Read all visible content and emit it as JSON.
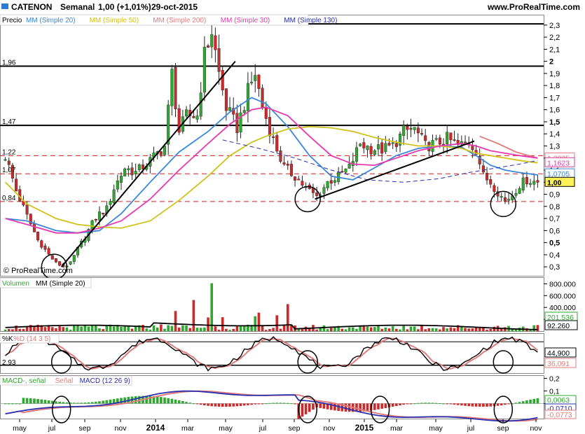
{
  "header": {
    "title": "CATENON",
    "period": "Semanal",
    "price_change": "1,00 (+1,01%)",
    "date": "29-oct-2015",
    "site": "www.ProRealTime.com"
  },
  "watermark": "© ProRealTime.com",
  "main_panel": {
    "label_price": "Precio",
    "legend": [
      {
        "label": "MM (Simple 20)",
        "color": "#3a86d8"
      },
      {
        "label": "MM (Simple 50)",
        "color": "#cfc21b"
      },
      {
        "label": "MM (Simple 200)",
        "color": "#e07c7c"
      },
      {
        "label": "MM (Simple 30)",
        "color": "#e838b0"
      },
      {
        "label": "MM (Simple 130)",
        "color": "#2c2fb0"
      }
    ],
    "y_ticks": [
      "2,3",
      "2,2",
      "2,1",
      "2",
      "1,9",
      "1,8",
      "1,7",
      "1,6",
      "1,5",
      "1,4",
      "1,3",
      "1,2",
      "1,1",
      "1",
      "0,9",
      "0,8",
      "0,7",
      "0,6",
      "0,5",
      "0,4",
      "0,3"
    ],
    "bold_ticks": [
      "2",
      "1,5",
      "1",
      "0,5"
    ],
    "level_labels": [
      "2,31",
      "1,96",
      "1,47",
      "1,22",
      "1,07",
      "0,84"
    ],
    "value_boxes": [
      {
        "text": "1,2025",
        "bg": "#ffffff",
        "fg": "#e07c7c"
      },
      {
        "text": "1,1623",
        "bg": "#ffffff",
        "fg": "#cf3d9a"
      },
      {
        "text": "1,0705",
        "bg": "#ffffff",
        "fg": "#3a86d8"
      },
      {
        "text": "1,00",
        "bg": "#fff15a",
        "fg": "#000000"
      }
    ]
  },
  "volume_panel": {
    "legend": [
      {
        "label": "Volumen",
        "color": "#2ea82e"
      },
      {
        "label": "MM (Simple 20)",
        "color": "#000000"
      }
    ],
    "y_ticks": [
      "800.000",
      "600.000",
      "400.000",
      "200.000"
    ],
    "value_boxes": [
      {
        "text": "201.536",
        "fg": "#2ea82e"
      },
      {
        "text": "92.260",
        "fg": "#000000"
      }
    ]
  },
  "stoch_panel": {
    "legend": [
      {
        "label": "%K",
        "color": "#000000"
      },
      {
        "label": "%D (14 3 5)",
        "color": "#e07c7c"
      }
    ],
    "left_label": "2,93",
    "value_boxes": [
      {
        "text": "44,900",
        "fg": "#000000"
      },
      {
        "text": "36,091",
        "fg": "#e07c7c"
      }
    ]
  },
  "macd_panel": {
    "legend": [
      {
        "label": "MACD-, señal",
        "color": "#2ea82e"
      },
      {
        "label": "Señal",
        "color": "#e07c7c"
      },
      {
        "label": "MACD (12 26 9)",
        "color": "#2c2fb0"
      }
    ],
    "y_ticks": [
      "0,2",
      "0,1",
      "0"
    ],
    "value_boxes": [
      {
        "text": "0,0063",
        "fg": "#2ea82e"
      },
      {
        "text": "-0,0710",
        "fg": "#2c2fb0"
      },
      {
        "text": "-0,0773",
        "fg": "#e07c7c"
      }
    ]
  },
  "x_axis": {
    "labels": [
      "may",
      "jul",
      "sep",
      "nov",
      "2014",
      "mar",
      "may",
      "jul",
      "sep",
      "nov",
      "2015",
      "mar",
      "may",
      "jul",
      "sep",
      "nov"
    ],
    "bold": [
      "2014",
      "2015"
    ]
  },
  "chart_data": {
    "type": "candlestick",
    "title": "CATENON Semanal",
    "ylim": [
      0.22,
      2.38
    ],
    "horizontal_levels_solid": [
      2.31,
      1.96,
      1.47
    ],
    "horizontal_levels_dashed": [
      1.22,
      1.07,
      0.84
    ],
    "weeks": 148,
    "close_path": [
      [
        0,
        1.22
      ],
      [
        3,
        0.93
      ],
      [
        6,
        0.72
      ],
      [
        9,
        0.52
      ],
      [
        12,
        0.4
      ],
      [
        14,
        0.33
      ],
      [
        16,
        0.3
      ],
      [
        18,
        0.33
      ],
      [
        20,
        0.45
      ],
      [
        22,
        0.55
      ],
      [
        24,
        0.66
      ],
      [
        26,
        0.74
      ],
      [
        28,
        0.78
      ],
      [
        30,
        0.95
      ],
      [
        33,
        1.12
      ],
      [
        36,
        1.08
      ],
      [
        40,
        1.18
      ],
      [
        44,
        1.3
      ],
      [
        46,
        1.9
      ],
      [
        48,
        1.42
      ],
      [
        50,
        1.55
      ],
      [
        53,
        1.55
      ],
      [
        55,
        2.05
      ],
      [
        57,
        2.25
      ],
      [
        59,
        1.9
      ],
      [
        61,
        1.62
      ],
      [
        64,
        1.45
      ],
      [
        67,
        1.75
      ],
      [
        69,
        1.9
      ],
      [
        71,
        1.62
      ],
      [
        74,
        1.35
      ],
      [
        77,
        1.12
      ],
      [
        80,
        1.05
      ],
      [
        83,
        0.95
      ],
      [
        86,
        0.88
      ],
      [
        89,
        1.0
      ],
      [
        92,
        1.05
      ],
      [
        95,
        1.12
      ],
      [
        98,
        1.32
      ],
      [
        101,
        1.28
      ],
      [
        104,
        1.27
      ],
      [
        107,
        1.3
      ],
      [
        110,
        1.42
      ],
      [
        113,
        1.44
      ],
      [
        116,
        1.3
      ],
      [
        119,
        1.32
      ],
      [
        122,
        1.36
      ],
      [
        125,
        1.3
      ],
      [
        128,
        1.33
      ],
      [
        130,
        1.27
      ],
      [
        132,
        1.05
      ],
      [
        134,
        1.0
      ],
      [
        136,
        0.92
      ],
      [
        138,
        0.84
      ],
      [
        140,
        0.9
      ],
      [
        142,
        0.98
      ],
      [
        144,
        1.02
      ],
      [
        147,
        1.0
      ]
    ],
    "series": [
      {
        "name": "MM (Simple 20)",
        "x": [
          0,
          6,
          14,
          20,
          26,
          32,
          40,
          48,
          56,
          62,
          68,
          72,
          78,
          84,
          90,
          96,
          102,
          108,
          114,
          120,
          126,
          130,
          134,
          138,
          142,
          147
        ],
        "y": [
          0.7,
          0.68,
          0.6,
          0.58,
          0.6,
          0.74,
          1.0,
          1.25,
          1.42,
          1.58,
          1.7,
          1.65,
          1.46,
          1.22,
          1.05,
          1.02,
          1.12,
          1.22,
          1.28,
          1.3,
          1.29,
          1.22,
          1.14,
          1.1,
          1.08,
          1.06
        ]
      },
      {
        "name": "MM (Simple 50)",
        "x": [
          0,
          6,
          14,
          20,
          26,
          32,
          40,
          48,
          56,
          62,
          68,
          72,
          78,
          84,
          90,
          96,
          102,
          108,
          114,
          120,
          126,
          130,
          134,
          138,
          142,
          147
        ],
        "y": [
          1.0,
          0.82,
          0.7,
          0.65,
          0.63,
          0.62,
          0.68,
          0.85,
          1.05,
          1.22,
          1.33,
          1.38,
          1.44,
          1.46,
          1.45,
          1.42,
          1.37,
          1.33,
          1.3,
          1.3,
          1.28,
          1.24,
          1.22,
          1.2,
          1.18,
          1.16
        ]
      },
      {
        "name": "MM (Simple 200)",
        "x": [
          131,
          136,
          141,
          147
        ],
        "y": [
          1.38,
          1.32,
          1.25,
          1.2
        ]
      },
      {
        "name": "MM (Simple 30)",
        "x": [
          0,
          6,
          14,
          20,
          26,
          32,
          40,
          48,
          56,
          62,
          68,
          72,
          78,
          84,
          90,
          96,
          102,
          108,
          114,
          120,
          126,
          130,
          134,
          138,
          142,
          147
        ],
        "y": [
          0.7,
          0.65,
          0.58,
          0.58,
          0.62,
          0.68,
          0.86,
          1.1,
          1.32,
          1.48,
          1.6,
          1.62,
          1.55,
          1.38,
          1.22,
          1.15,
          1.14,
          1.2,
          1.26,
          1.3,
          1.32,
          1.3,
          1.26,
          1.24,
          1.22,
          1.2
        ]
      },
      {
        "name": "MM (Simple 130)",
        "x": [
          60,
          70,
          80,
          90,
          100,
          110,
          120,
          128,
          136,
          142,
          147
        ],
        "y": [
          1.35,
          1.28,
          1.2,
          1.1,
          1.02,
          1.0,
          1.03,
          1.08,
          1.12,
          1.15,
          1.18
        ]
      }
    ]
  }
}
